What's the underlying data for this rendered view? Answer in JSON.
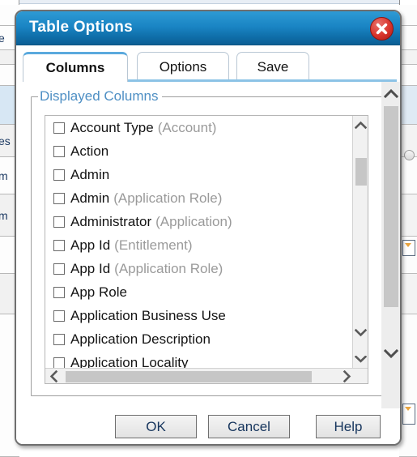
{
  "dialog": {
    "title": "Table Options",
    "close_icon": "close-circle-icon"
  },
  "tabs": [
    {
      "label": "Columns",
      "active": true
    },
    {
      "label": "Options",
      "active": false
    },
    {
      "label": "Save",
      "active": false
    }
  ],
  "fieldset": {
    "legend": "Displayed Columns"
  },
  "columns": [
    {
      "name": "Account Type",
      "qualifier": "(Account)",
      "checked": false
    },
    {
      "name": "Action",
      "qualifier": "",
      "checked": false
    },
    {
      "name": "Admin",
      "qualifier": "",
      "checked": false
    },
    {
      "name": "Admin",
      "qualifier": "(Application Role)",
      "checked": false
    },
    {
      "name": "Administrator",
      "qualifier": "(Application)",
      "checked": false
    },
    {
      "name": "App Id",
      "qualifier": "(Entitlement)",
      "checked": false
    },
    {
      "name": "App Id",
      "qualifier": "(Application Role)",
      "checked": false
    },
    {
      "name": "App Role",
      "qualifier": "",
      "checked": false
    },
    {
      "name": "Application Business Use",
      "qualifier": "",
      "checked": false
    },
    {
      "name": "Application Description",
      "qualifier": "",
      "checked": false
    },
    {
      "name": "Application Locality",
      "qualifier": "",
      "checked": false
    }
  ],
  "scrollbars": {
    "list_vertical": {
      "up_icon": "chevron-up-icon",
      "down_icon": "chevron-down-icon"
    },
    "list_horizontal": {
      "left_icon": "chevron-left-icon",
      "right_icon": "chevron-right-icon"
    },
    "dialog_vertical": {
      "up_icon": "chevron-up-icon",
      "down_icon": "chevron-down-icon"
    }
  },
  "footer": {
    "ok": "OK",
    "cancel": "Cancel",
    "help": "Help"
  },
  "colors": {
    "titlebar": "#1a85c4",
    "legend": "#4e8fc4",
    "tab_accent": "#8cc3e6",
    "close_red": "#d8342c",
    "qualifier_gray": "#9a9a9a",
    "button_text": "#16355d"
  },
  "background": {
    "left_fragments": [
      "e",
      "es",
      "m",
      "m"
    ],
    "right_rows": 9
  }
}
